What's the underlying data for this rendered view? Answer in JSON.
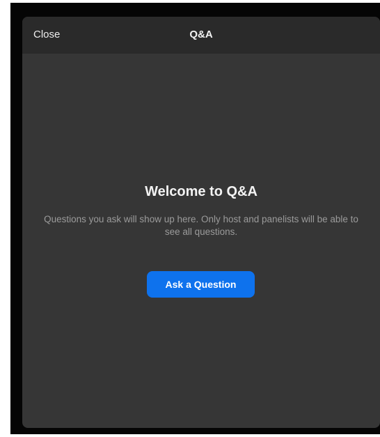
{
  "header": {
    "close_label": "Close",
    "title": "Q&A"
  },
  "main": {
    "welcome_title": "Welcome to Q&A",
    "description": "Questions you ask will show up here. Only host and panelists will be able to see all questions.",
    "ask_button_label": "Ask a Question"
  },
  "colors": {
    "panel_background": "#363636",
    "header_background": "#2a2a2a",
    "accent": "#0e72ed"
  }
}
